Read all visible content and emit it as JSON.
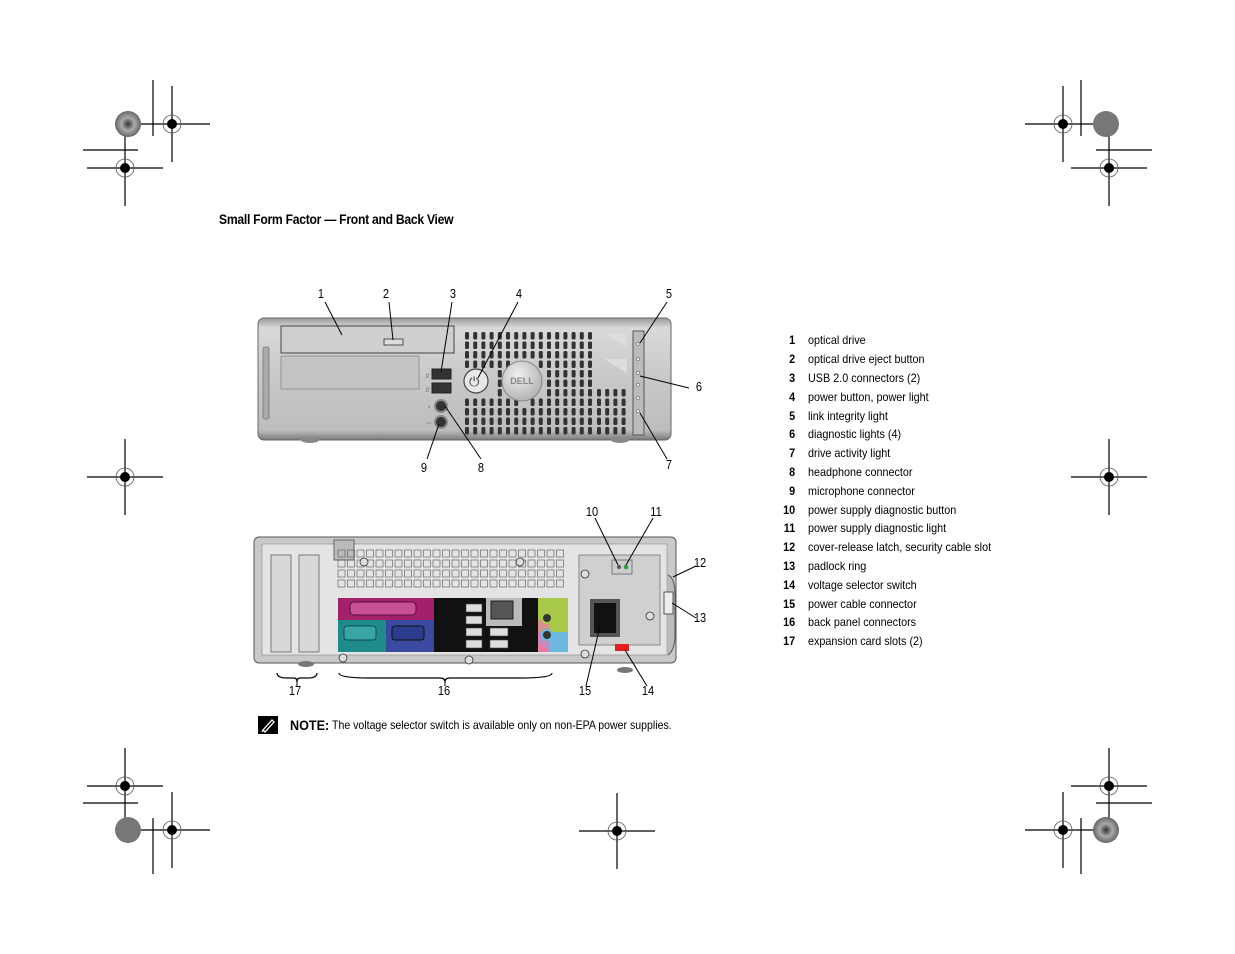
{
  "section_title": "Small Form Factor — Front and Back View",
  "front_view": {
    "callouts": [
      "1",
      "2",
      "3",
      "4",
      "5",
      "6",
      "7",
      "8",
      "9"
    ],
    "logo_text": "DELL"
  },
  "back_view": {
    "callouts": [
      "10",
      "11",
      "12",
      "13",
      "14",
      "15",
      "16",
      "17"
    ],
    "colors": {
      "parallel": "#a3216b",
      "serial": "#1f8a8a",
      "vga": "#3a4aa0",
      "audio_line_out": "#a8c84a",
      "audio_line_in": "#e87aa8",
      "audio_mic": "#6cb8e0",
      "voltage_switch": "#e02020",
      "diag_light": "#2e9e3e"
    }
  },
  "legend": [
    {
      "num": "1",
      "label": "optical drive"
    },
    {
      "num": "2",
      "label": "optical drive eject button"
    },
    {
      "num": "3",
      "label": "USB 2.0 connectors (2)"
    },
    {
      "num": "4",
      "label": "power button, power light"
    },
    {
      "num": "5",
      "label": "link integrity light"
    },
    {
      "num": "6",
      "label": "diagnostic lights (4)"
    },
    {
      "num": "7",
      "label": "drive activity light"
    },
    {
      "num": "8",
      "label": "headphone connector"
    },
    {
      "num": "9",
      "label": "microphone connector"
    },
    {
      "num": "10",
      "label": "power supply diagnostic button"
    },
    {
      "num": "11",
      "label": "power supply diagnostic light"
    },
    {
      "num": "12",
      "label": "cover-release latch, security cable slot"
    },
    {
      "num": "13",
      "label": "padlock ring"
    },
    {
      "num": "14",
      "label": "voltage selector switch"
    },
    {
      "num": "15",
      "label": "power cable connector"
    },
    {
      "num": "16",
      "label": "back panel connectors"
    },
    {
      "num": "17",
      "label": "expansion card slots (2)"
    }
  ],
  "note": {
    "icon": "pencil-note-icon",
    "label": "NOTE:",
    "text": "The voltage selector switch is available only on non-EPA power supplies."
  }
}
